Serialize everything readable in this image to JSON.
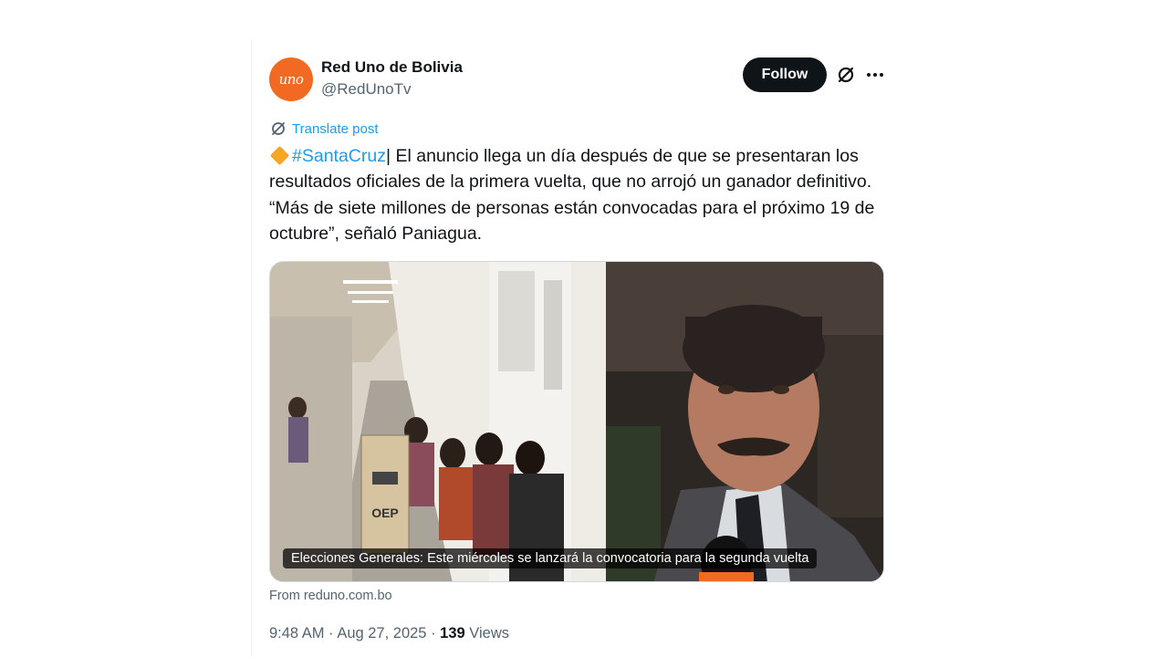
{
  "author": {
    "display_name": "Red Uno de Bolivia",
    "handle": "@RedUnoTv",
    "avatar_logo": "uno"
  },
  "actions": {
    "follow_label": "Follow",
    "grok_icon": "grok-icon",
    "more_icon": "more-icon"
  },
  "translate": {
    "label": "Translate post",
    "icon": "translate-icon"
  },
  "post": {
    "hashtag": "#SantaCruz",
    "separator": "|",
    "text": " El anuncio llega un día después de que se presentaran los resultados oficiales de la primera vuelta, que no arrojó un ganador definitivo. “Más de siete millones de personas están convocadas para el próximo 19 de octubre”, señaló Paniagua."
  },
  "media": {
    "caption": "Elecciones Generales: Este miércoles se lanzará la convocatoria para la segunda vuelta",
    "ballot_box_label": "OEP"
  },
  "source": {
    "from_label": "From reduno.com.bo"
  },
  "meta": {
    "time": "9:48 AM",
    "dot1": " · ",
    "date": "Aug 27, 2025",
    "dot2": " · ",
    "views_count": "139",
    "views_label": " Views"
  },
  "colors": {
    "accent": "#1d9bf0",
    "avatar_bg": "#f26a21",
    "follow_bg": "#0f1419",
    "secondary_text": "#536471"
  }
}
